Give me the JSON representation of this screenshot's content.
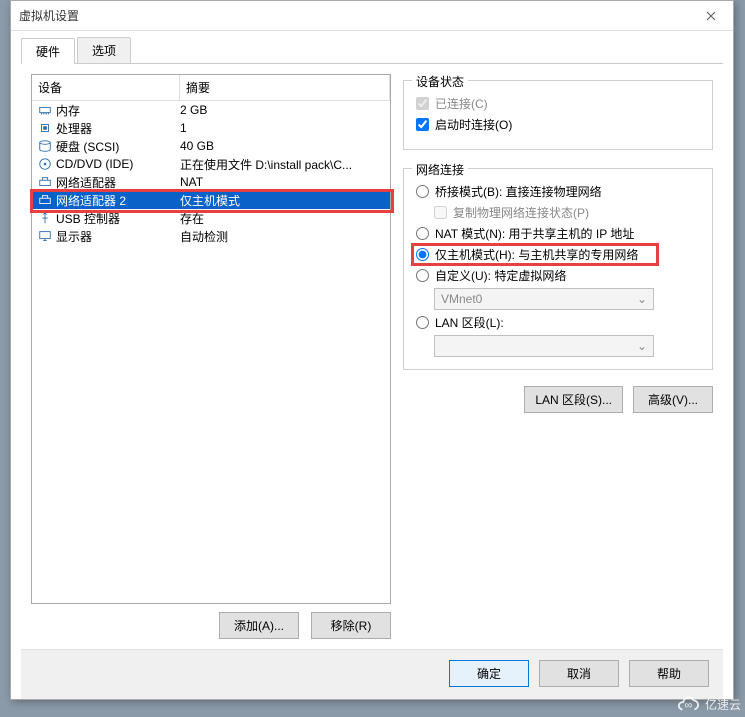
{
  "window": {
    "title": "虚拟机设置"
  },
  "tabs": {
    "hardware": "硬件",
    "options": "选项"
  },
  "headers": {
    "device": "设备",
    "summary": "摘要"
  },
  "devices": [
    {
      "icon": "memory",
      "label": "内存",
      "summary": "2 GB"
    },
    {
      "icon": "cpu",
      "label": "处理器",
      "summary": "1"
    },
    {
      "icon": "disk",
      "label": "硬盘 (SCSI)",
      "summary": "40 GB"
    },
    {
      "icon": "cd",
      "label": "CD/DVD (IDE)",
      "summary": "正在使用文件 D:\\install pack\\C..."
    },
    {
      "icon": "nic",
      "label": "网络适配器",
      "summary": "NAT"
    },
    {
      "icon": "nic",
      "label": "网络适配器 2",
      "summary": "仅主机模式"
    },
    {
      "icon": "usb",
      "label": "USB 控制器",
      "summary": "存在"
    },
    {
      "icon": "display",
      "label": "显示器",
      "summary": "自动检测"
    }
  ],
  "selected_device_index": 5,
  "buttons": {
    "add": "添加(A)...",
    "remove": "移除(R)",
    "lan_seg_btn": "LAN 区段(S)...",
    "advanced_btn": "高级(V)...",
    "ok": "确定",
    "cancel": "取消",
    "help": "帮助"
  },
  "status_group": {
    "title": "设备状态",
    "connected": "已连接(C)",
    "connect_on_power": "启动时连接(O)"
  },
  "net_group": {
    "title": "网络连接",
    "bridge": "桥接模式(B): 直接连接物理网络",
    "replicate": "复制物理网络连接状态(P)",
    "nat": "NAT 模式(N): 用于共享主机的 IP 地址",
    "hostonly": "仅主机模式(H): 与主机共享的专用网络",
    "custom": "自定义(U): 特定虚拟网络",
    "vmnet": "VMnet0",
    "lan_segment": "LAN 区段(L):"
  },
  "watermark": "亿速云"
}
